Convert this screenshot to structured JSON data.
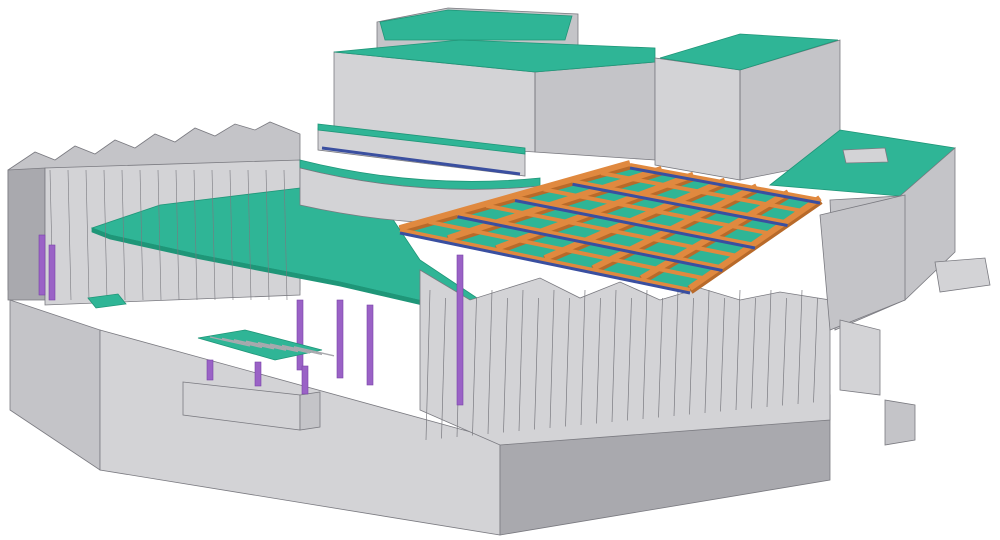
{
  "scene": {
    "subject": "building-structure-model",
    "colors": {
      "background": "#ffffff",
      "concrete_light": "#d3d3d6",
      "concrete_mid": "#c4c4c8",
      "concrete_dark": "#a9a9ae",
      "edge": "#7a7a80",
      "slab": "#2fb596",
      "slab_dark": "#1f9678",
      "timber_beam": "#e0893f",
      "timber_beam_dark": "#b86a2a",
      "steel_beam": "#3a4fa0",
      "column": "#9a62c6",
      "column_dark": "#7a44a8",
      "rail_green": "#8fbf3a"
    }
  }
}
